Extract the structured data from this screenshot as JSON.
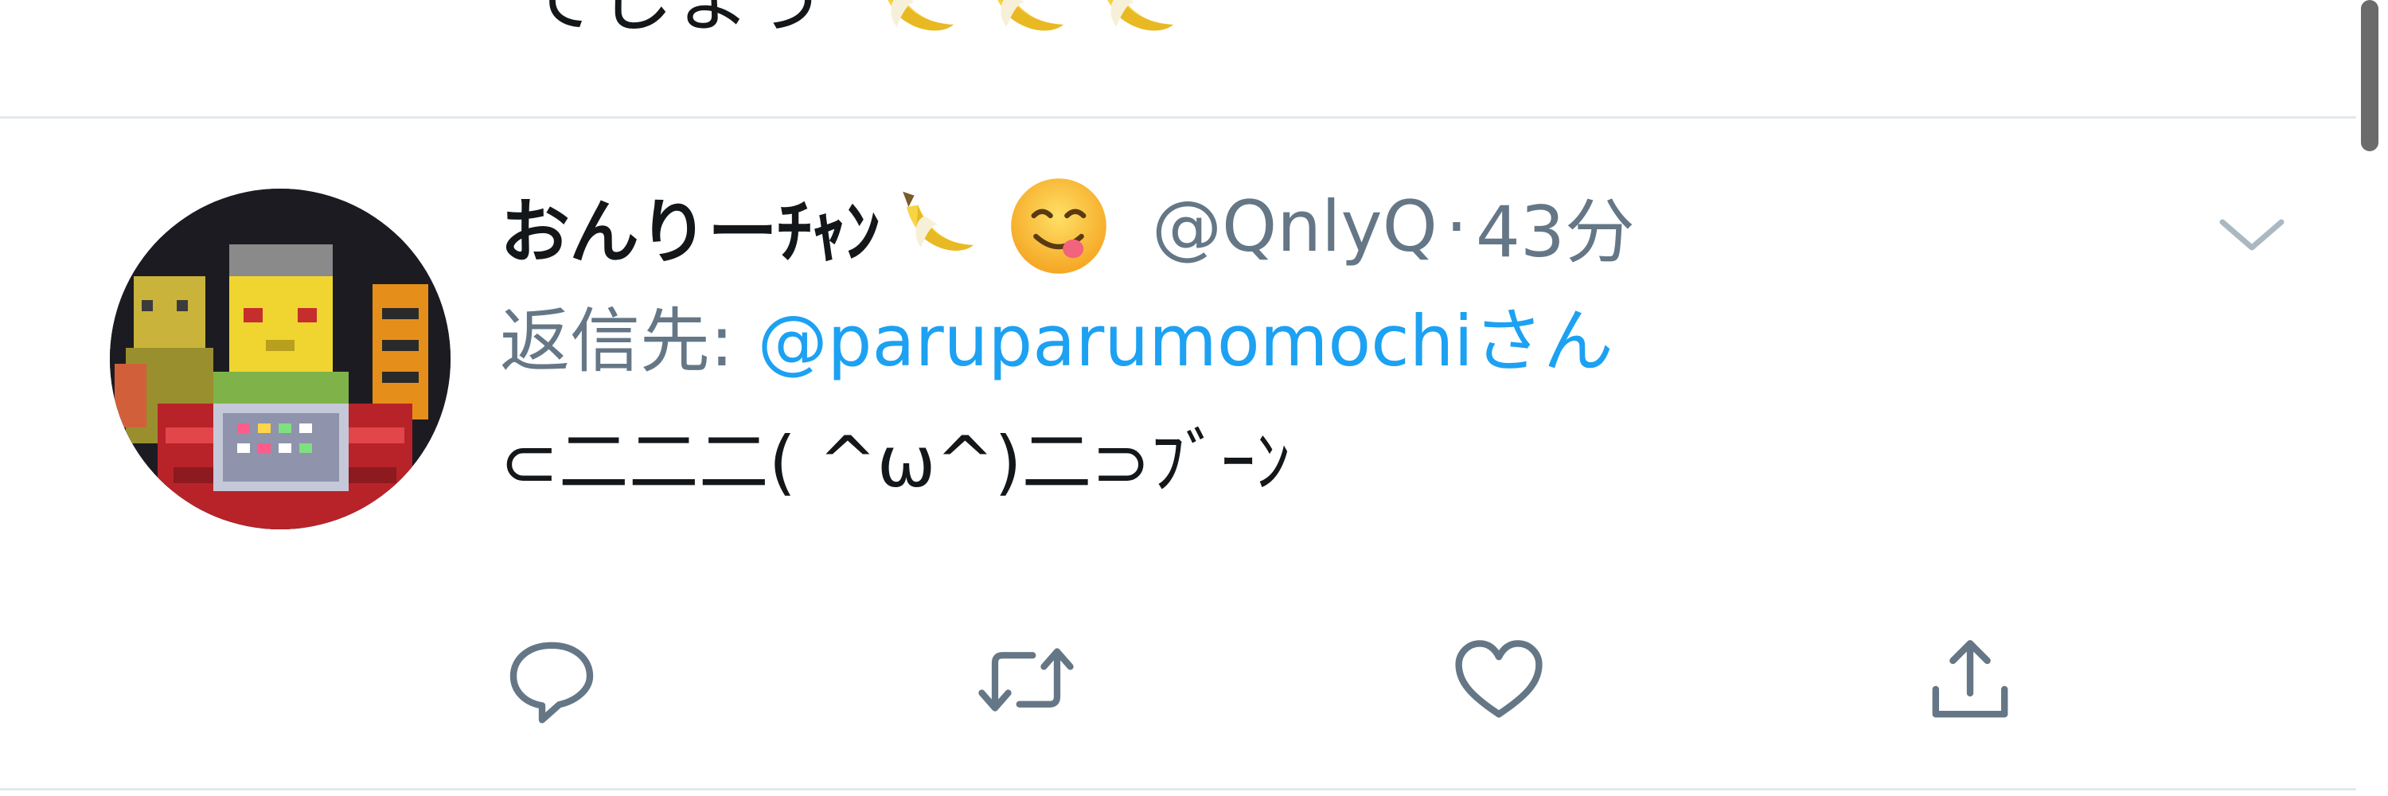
{
  "previous_tweet": {
    "text_fragment": "てしまう",
    "emojis": [
      "banana",
      "banana",
      "banana"
    ]
  },
  "tweet": {
    "display_name": "おんりーﾁｬﾝ",
    "name_emojis": [
      "banana",
      "face-savoring-food"
    ],
    "handle": "@QnlyQ",
    "separator": "·",
    "time": "43分",
    "reply_prefix": "返信先:",
    "reply_target": "@paruparumomochiさん",
    "text": "⊂二二二( ^ω^)二⊃ﾌﾞｰﾝ"
  },
  "actions": [
    {
      "name": "reply",
      "icon": "reply-icon"
    },
    {
      "name": "retweet",
      "icon": "retweet-icon"
    },
    {
      "name": "like",
      "icon": "heart-icon"
    },
    {
      "name": "share",
      "icon": "share-icon"
    }
  ],
  "colors": {
    "text_primary": "#14171a",
    "text_secondary": "#657786",
    "link": "#1da1f2",
    "divider": "#e1e8ed",
    "icon": "#657786"
  }
}
